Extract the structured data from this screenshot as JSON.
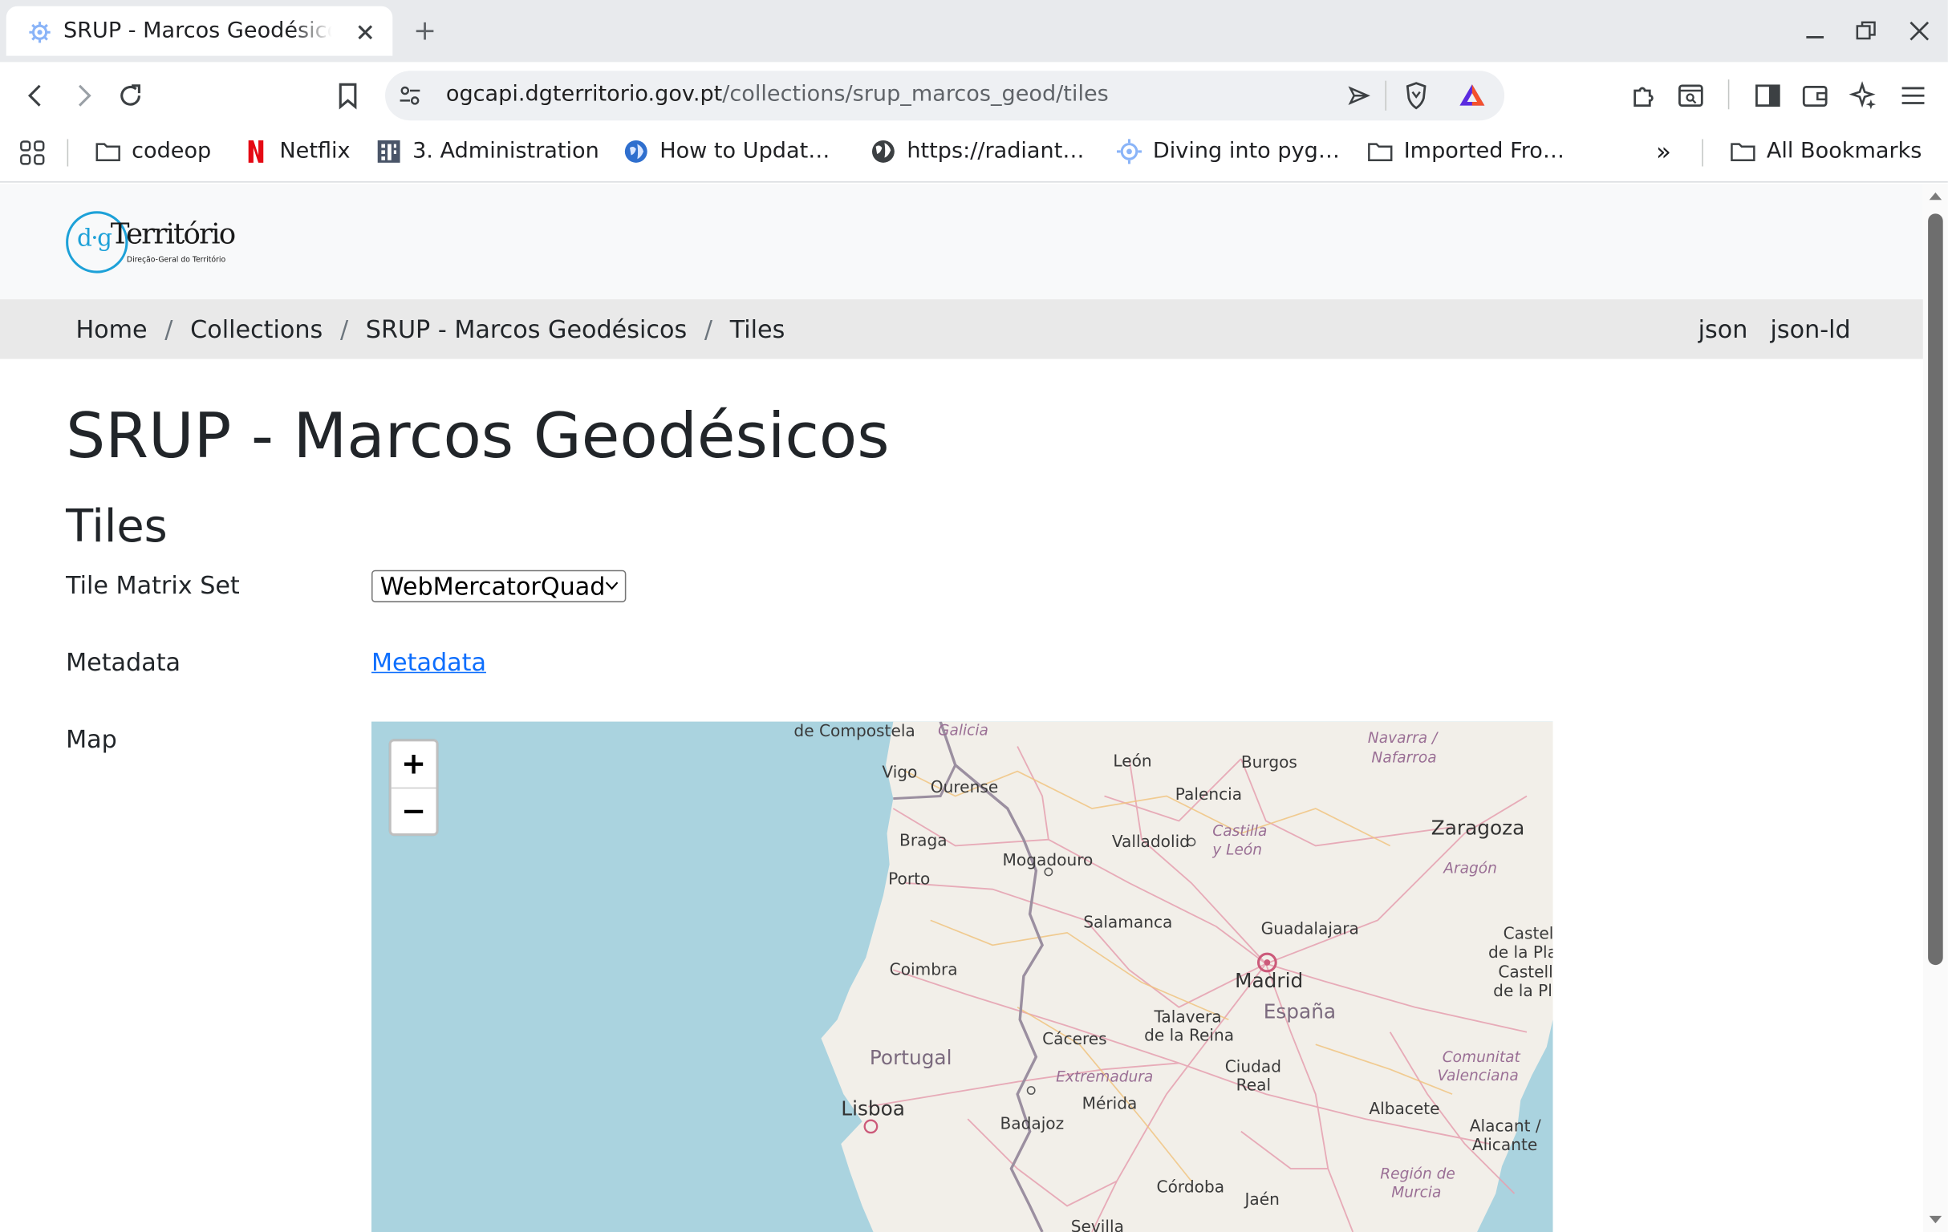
{
  "browser": {
    "tab_title": "SRUP - Marcos Geodésicos",
    "url_host": "ogcapi.dgterritorio.gov.pt",
    "url_path": "/collections/srup_marcos_geod/tiles",
    "bookmarks": [
      {
        "label": "codeop",
        "icon": "folder-icon"
      },
      {
        "label": "Netflix",
        "icon": "netflix-icon"
      },
      {
        "label": "3. Administration",
        "icon": "building-icon"
      },
      {
        "label": "How to Updat…",
        "icon": "globe-site-icon"
      },
      {
        "label": "https://radiant…",
        "icon": "globe-icon"
      },
      {
        "label": "Diving into pyg…",
        "icon": "gear-site-icon"
      },
      {
        "label": "Imported Fro…",
        "icon": "folder-icon"
      }
    ],
    "all_bookmarks_label": "All Bookmarks",
    "overflow_label": "»"
  },
  "site": {
    "logo_main": "Território",
    "logo_prefix": "d·g",
    "logo_tagline": "Direção-Geral do Território"
  },
  "breadcrumb": {
    "items": [
      "Home",
      "Collections",
      "SRUP - Marcos Geodésicos",
      "Tiles"
    ],
    "separator": "/",
    "formats": [
      "json",
      "json-ld"
    ]
  },
  "main": {
    "title": "SRUP - Marcos Geodésicos",
    "subtitle": "Tiles",
    "tile_matrix_label": "Tile Matrix Set",
    "tile_matrix_value": "WebMercatorQuad",
    "metadata_label": "Metadata",
    "metadata_link": "Metadata",
    "map_label": "Map"
  },
  "map": {
    "zoom_in": "+",
    "zoom_out": "−",
    "places": [
      "de Compostela",
      "Galicia",
      "Vigo",
      "Ourense",
      "León",
      "Burgos",
      "Navarra /",
      "Nafarroa",
      "Palencia",
      "Castilla",
      "y León",
      "Zaragoza",
      "Braga",
      "Valladolid",
      "Mogadouro",
      "Aragón",
      "Porto",
      "Salamanca",
      "Guadalajara",
      "Castel",
      "de la Pla",
      "Castell",
      "de la Pl",
      "Coimbra",
      "Madrid",
      "España",
      "Talavera",
      "de la Reina",
      "Cáceres",
      "Portugal",
      "Ciudad",
      "Real",
      "Comunitat",
      "Valenciana",
      "Extremadura",
      "Lisboa",
      "Mérida",
      "Badajoz",
      "Albacete",
      "Alacant /",
      "Alicante",
      "Región de",
      "Murcia",
      "Córdoba",
      "Jaén",
      "Sevilla"
    ]
  },
  "colors": {
    "water": "#aad3df",
    "land": "#f2efe9",
    "link": "#0d6efd",
    "crumb_bg": "#e9e9e9",
    "header_bg": "#f8f9fa"
  }
}
